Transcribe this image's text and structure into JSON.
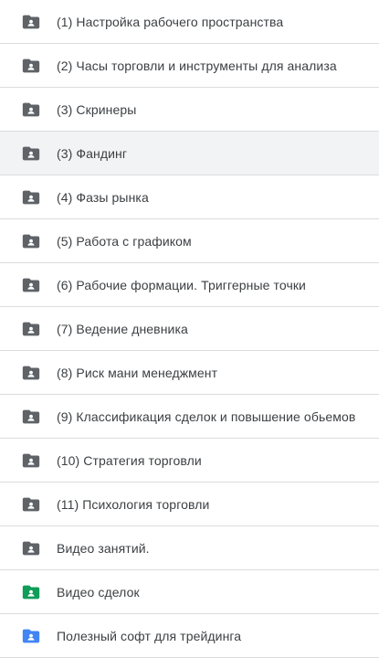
{
  "folders": [
    {
      "label": "(1) Настройка рабочего пространства",
      "color": "#5f6368",
      "icon": "shared-folder-icon"
    },
    {
      "label": "(2) Часы торговли и инструменты для анализа",
      "color": "#5f6368",
      "icon": "shared-folder-icon"
    },
    {
      "label": "(3) Скринеры",
      "color": "#5f6368",
      "icon": "shared-folder-icon"
    },
    {
      "label": "(3) Фандинг",
      "color": "#5f6368",
      "icon": "shared-folder-icon",
      "selected": true
    },
    {
      "label": "(4) Фазы рынка",
      "color": "#5f6368",
      "icon": "shared-folder-icon"
    },
    {
      "label": "(5) Работа с графиком",
      "color": "#5f6368",
      "icon": "shared-folder-icon"
    },
    {
      "label": "(6) Рабочие формации. Триггерные точки",
      "color": "#5f6368",
      "icon": "shared-folder-icon"
    },
    {
      "label": "(7) Ведение дневника",
      "color": "#5f6368",
      "icon": "shared-folder-icon"
    },
    {
      "label": "(8) Риск мани менеджмент",
      "color": "#5f6368",
      "icon": "shared-folder-icon"
    },
    {
      "label": "(9) Классификация сделок и повышение обьемов",
      "color": "#5f6368",
      "icon": "shared-folder-icon"
    },
    {
      "label": "(10) Стратегия торговли",
      "color": "#5f6368",
      "icon": "shared-folder-icon"
    },
    {
      "label": "(11) Психология торговли",
      "color": "#5f6368",
      "icon": "shared-folder-icon"
    },
    {
      "label": "Видео занятий.",
      "color": "#5f6368",
      "icon": "shared-folder-icon"
    },
    {
      "label": "Видео сделок",
      "color": "#0f9d58",
      "icon": "shared-folder-icon"
    },
    {
      "label": "Полезный софт для трейдинга",
      "color": "#4285f4",
      "icon": "shared-folder-icon"
    }
  ]
}
